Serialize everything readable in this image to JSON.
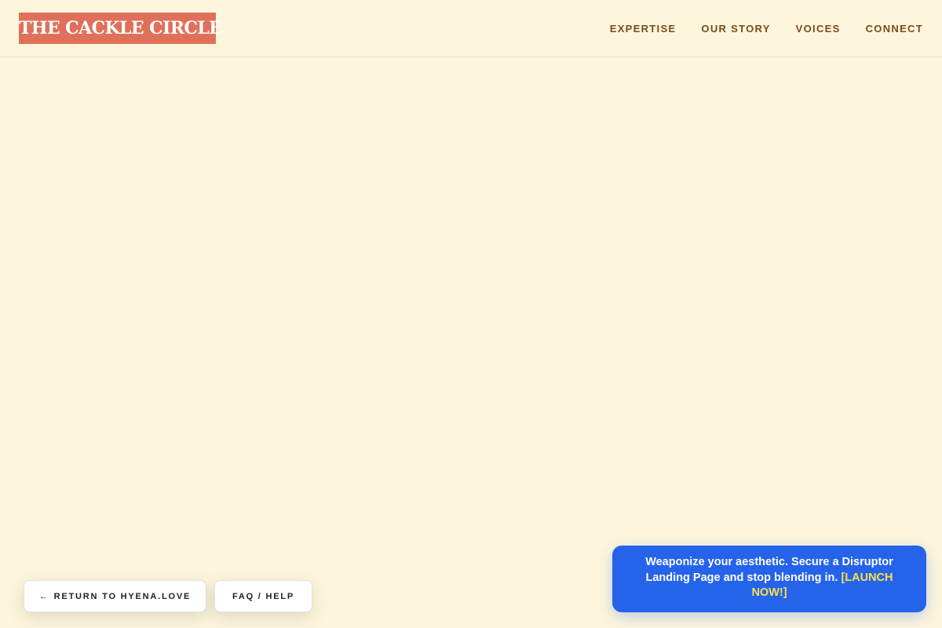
{
  "header": {
    "brand": "THE CACKLE CIRCLE",
    "nav": [
      {
        "label": "EXPERTISE"
      },
      {
        "label": "OUR STORY"
      },
      {
        "label": "VOICES"
      },
      {
        "label": "CONNECT"
      }
    ]
  },
  "footer_buttons": {
    "return_arrow": "←",
    "return_label": "RETURN TO HYENA.LOVE",
    "faq_label": "FAQ / HELP"
  },
  "promo": {
    "message": "Weaponize your aesthetic. Secure a Disruptor Landing Page and stop blending in.",
    "cta": "[LAUNCH NOW!]"
  },
  "colors": {
    "page_background": "#fdf6dc",
    "brand_badge": "#e0705a",
    "nav_text": "#7a4a1c",
    "promo_background": "#2563eb",
    "promo_cta": "#fde047"
  }
}
